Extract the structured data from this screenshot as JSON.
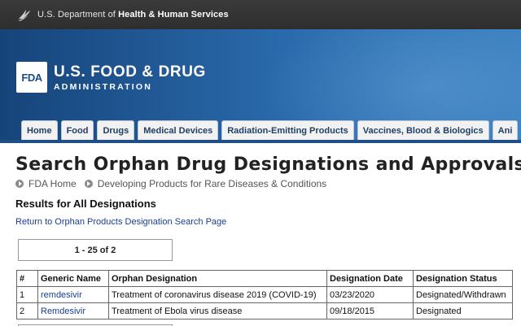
{
  "hhs": {
    "prefix": "U.S. Department of ",
    "bold": "Health & Human Services"
  },
  "fda": {
    "logo": "FDA",
    "title": "U.S. FOOD & DRUG",
    "subtitle": "ADMINISTRATION"
  },
  "nav": [
    {
      "label": "Home"
    },
    {
      "label": "Food"
    },
    {
      "label": "Drugs"
    },
    {
      "label": "Medical Devices"
    },
    {
      "label": "Radiation-Emitting Products"
    },
    {
      "label": "Vaccines, Blood & Biologics"
    },
    {
      "label": "Ani"
    }
  ],
  "page": {
    "title": "Search Orphan Drug Designations and Approvals",
    "breadcrumb": [
      "FDA Home",
      "Developing Products for Rare Diseases & Conditions"
    ],
    "results_heading": "Results for All Designations",
    "return_link": "Return to Orphan Products Designation Search Page",
    "pager": "1 - 25 of 2"
  },
  "table": {
    "headers": [
      "#",
      "Generic Name",
      "Orphan Designation",
      "Designation Date",
      "Designation Status"
    ],
    "rows": [
      [
        "1",
        "remdesivir",
        "Treatment of coronavirus disease 2019 (COVID-19)",
        "03/23/2020",
        "Designated/Withdrawn"
      ],
      [
        "2",
        "Remdesivir",
        "Treatment of Ebola virus disease",
        "09/18/2015",
        "Designated"
      ]
    ]
  },
  "colors": {
    "hhs_bar": "#333333",
    "fda_blue": "#1f4f86",
    "link": "#1a3f8f"
  }
}
